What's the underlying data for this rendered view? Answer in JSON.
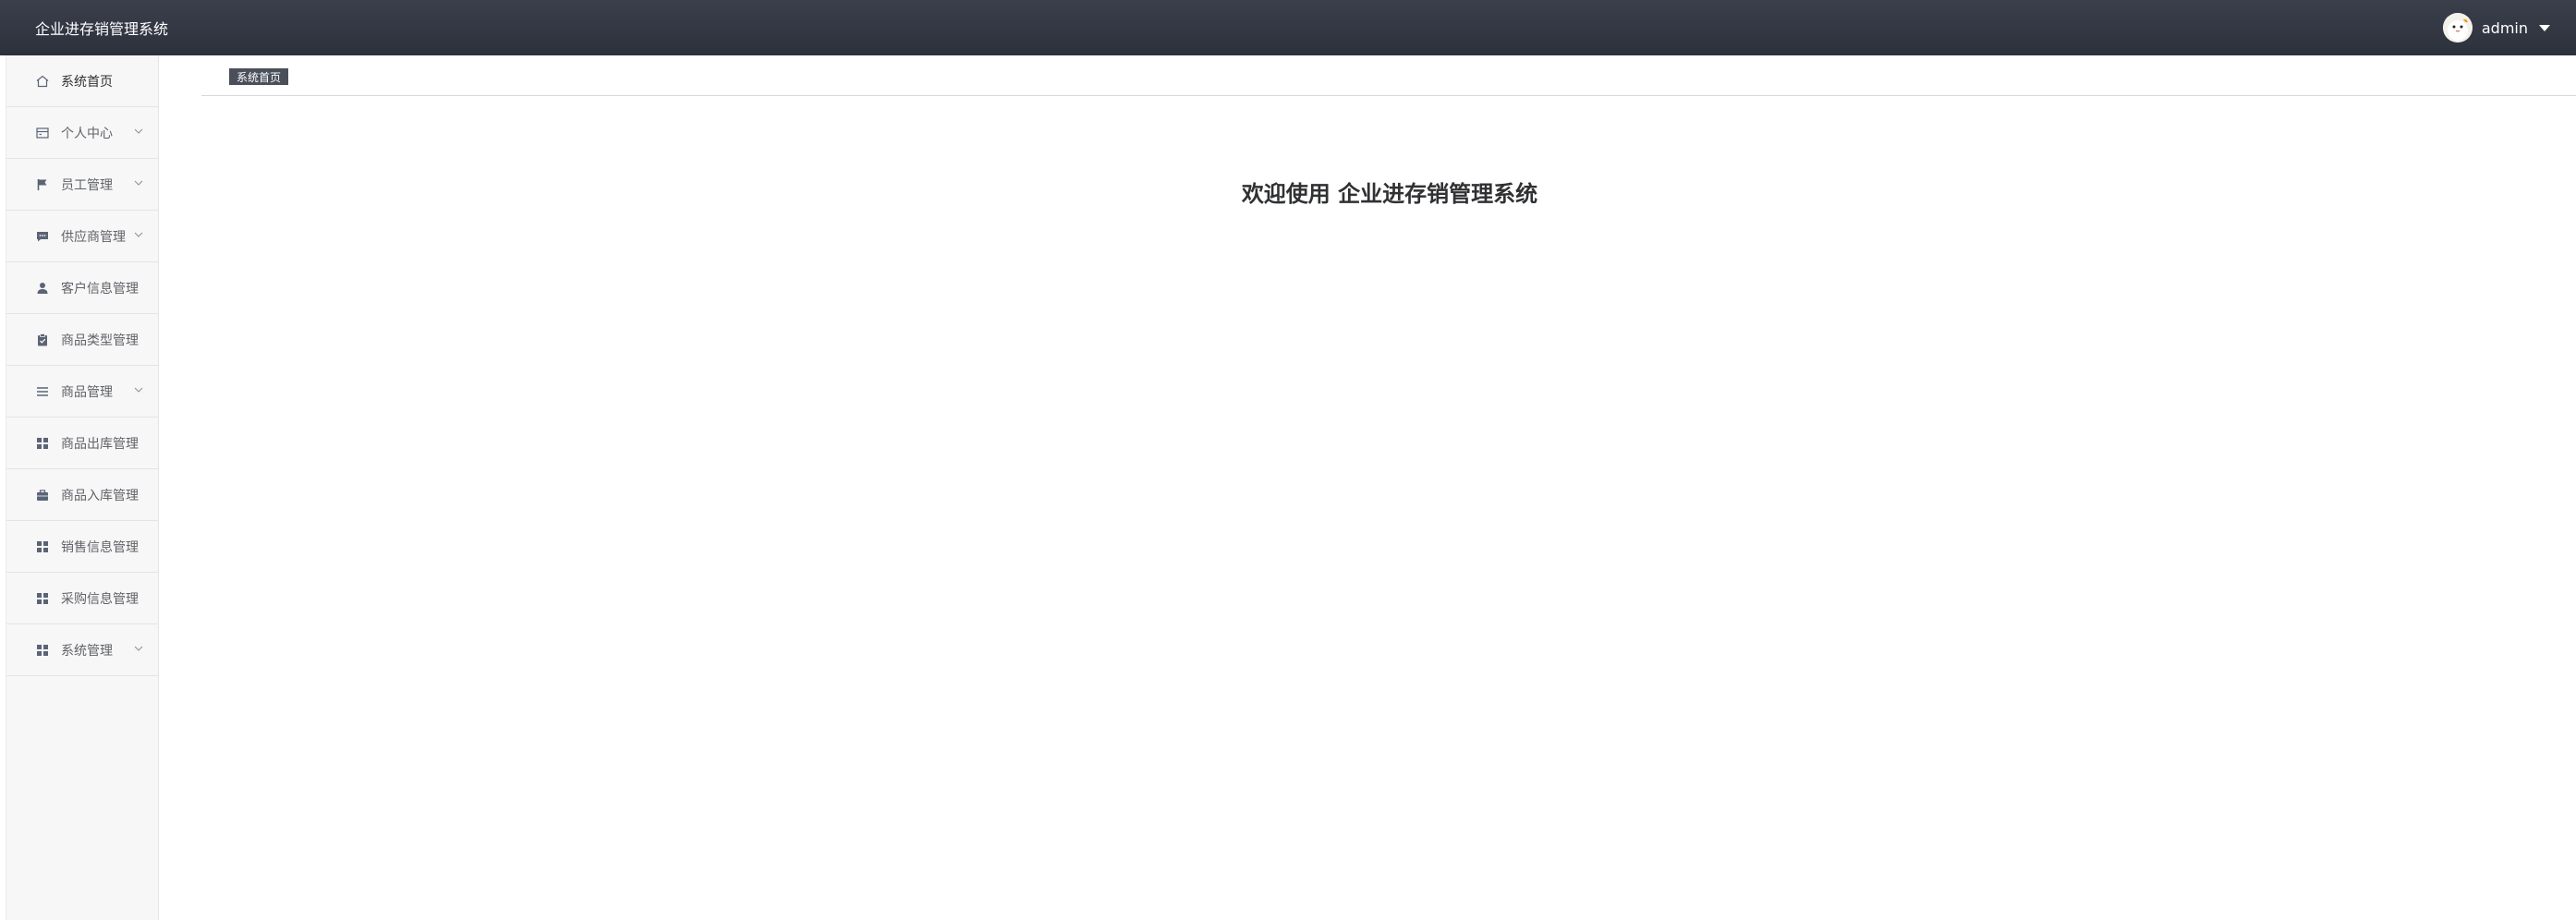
{
  "header": {
    "title": "企业进存销管理系统",
    "username": "admin"
  },
  "sidebar": {
    "items": [
      {
        "label": "系统首页",
        "icon": "home-icon",
        "dropdown": false
      },
      {
        "label": "个人中心",
        "icon": "calendar-icon",
        "dropdown": true
      },
      {
        "label": "员工管理",
        "icon": "flag-icon",
        "dropdown": true
      },
      {
        "label": "供应商管理",
        "icon": "chat-icon",
        "dropdown": true
      },
      {
        "label": "客户信息管理",
        "icon": "user-icon",
        "dropdown": false
      },
      {
        "label": "商品类型管理",
        "icon": "clipboard-icon",
        "dropdown": false
      },
      {
        "label": "商品管理",
        "icon": "list-icon",
        "dropdown": true
      },
      {
        "label": "商品出库管理",
        "icon": "grid-icon",
        "dropdown": false
      },
      {
        "label": "商品入库管理",
        "icon": "briefcase-icon",
        "dropdown": false
      },
      {
        "label": "销售信息管理",
        "icon": "grid-icon",
        "dropdown": false
      },
      {
        "label": "采购信息管理",
        "icon": "grid-icon",
        "dropdown": false
      },
      {
        "label": "系统管理",
        "icon": "grid-icon",
        "dropdown": true
      }
    ]
  },
  "tabs": [
    {
      "label": "系统首页"
    }
  ],
  "main": {
    "welcome": "欢迎使用 企业进存销管理系统"
  },
  "colors": {
    "header_bg": "#2c313c",
    "sidebar_bg": "#f7f7f8",
    "tab_bg": "#4a4f5a",
    "icon_color": "#5b6475"
  }
}
